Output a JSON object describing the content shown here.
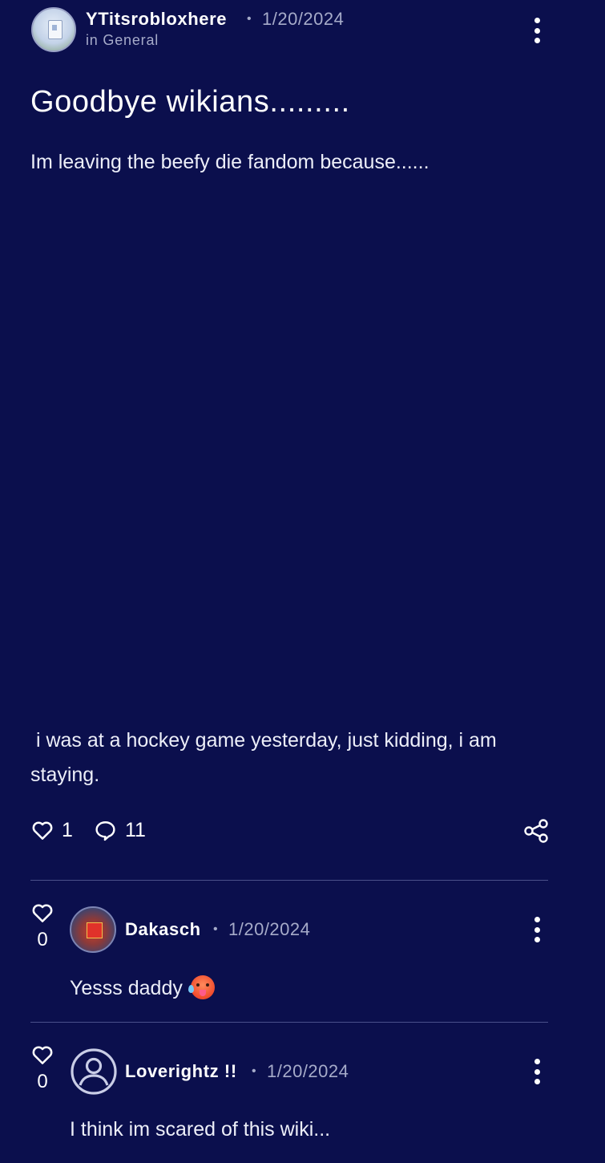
{
  "post": {
    "author": "YTitsrobloxhere",
    "separator": "•",
    "date": "1/20/2024",
    "category": "in General",
    "title": "Goodbye wikians.........",
    "intro": "Im leaving the beefy die fandom because......",
    "body": " i was at a hockey game yesterday, just kidding, i am staying.",
    "likes": "1",
    "comments": "11"
  },
  "replies": [
    {
      "likes": "0",
      "author": "Dakasch",
      "separator": "•",
      "date": "1/20/2024",
      "text": "Yesss daddy",
      "emoji": "hot-face-emoji",
      "avatar": "custom-image"
    },
    {
      "likes": "0",
      "author": "Loverightz !!",
      "separator": "•",
      "date": "1/20/2024",
      "text": "I think im scared of this wiki...",
      "avatar": "default-user-icon"
    }
  ],
  "colors": {
    "background": "#0b0f4d",
    "text": "#ffffff",
    "muted": "#a6abc9",
    "divider": "#4a508a"
  }
}
